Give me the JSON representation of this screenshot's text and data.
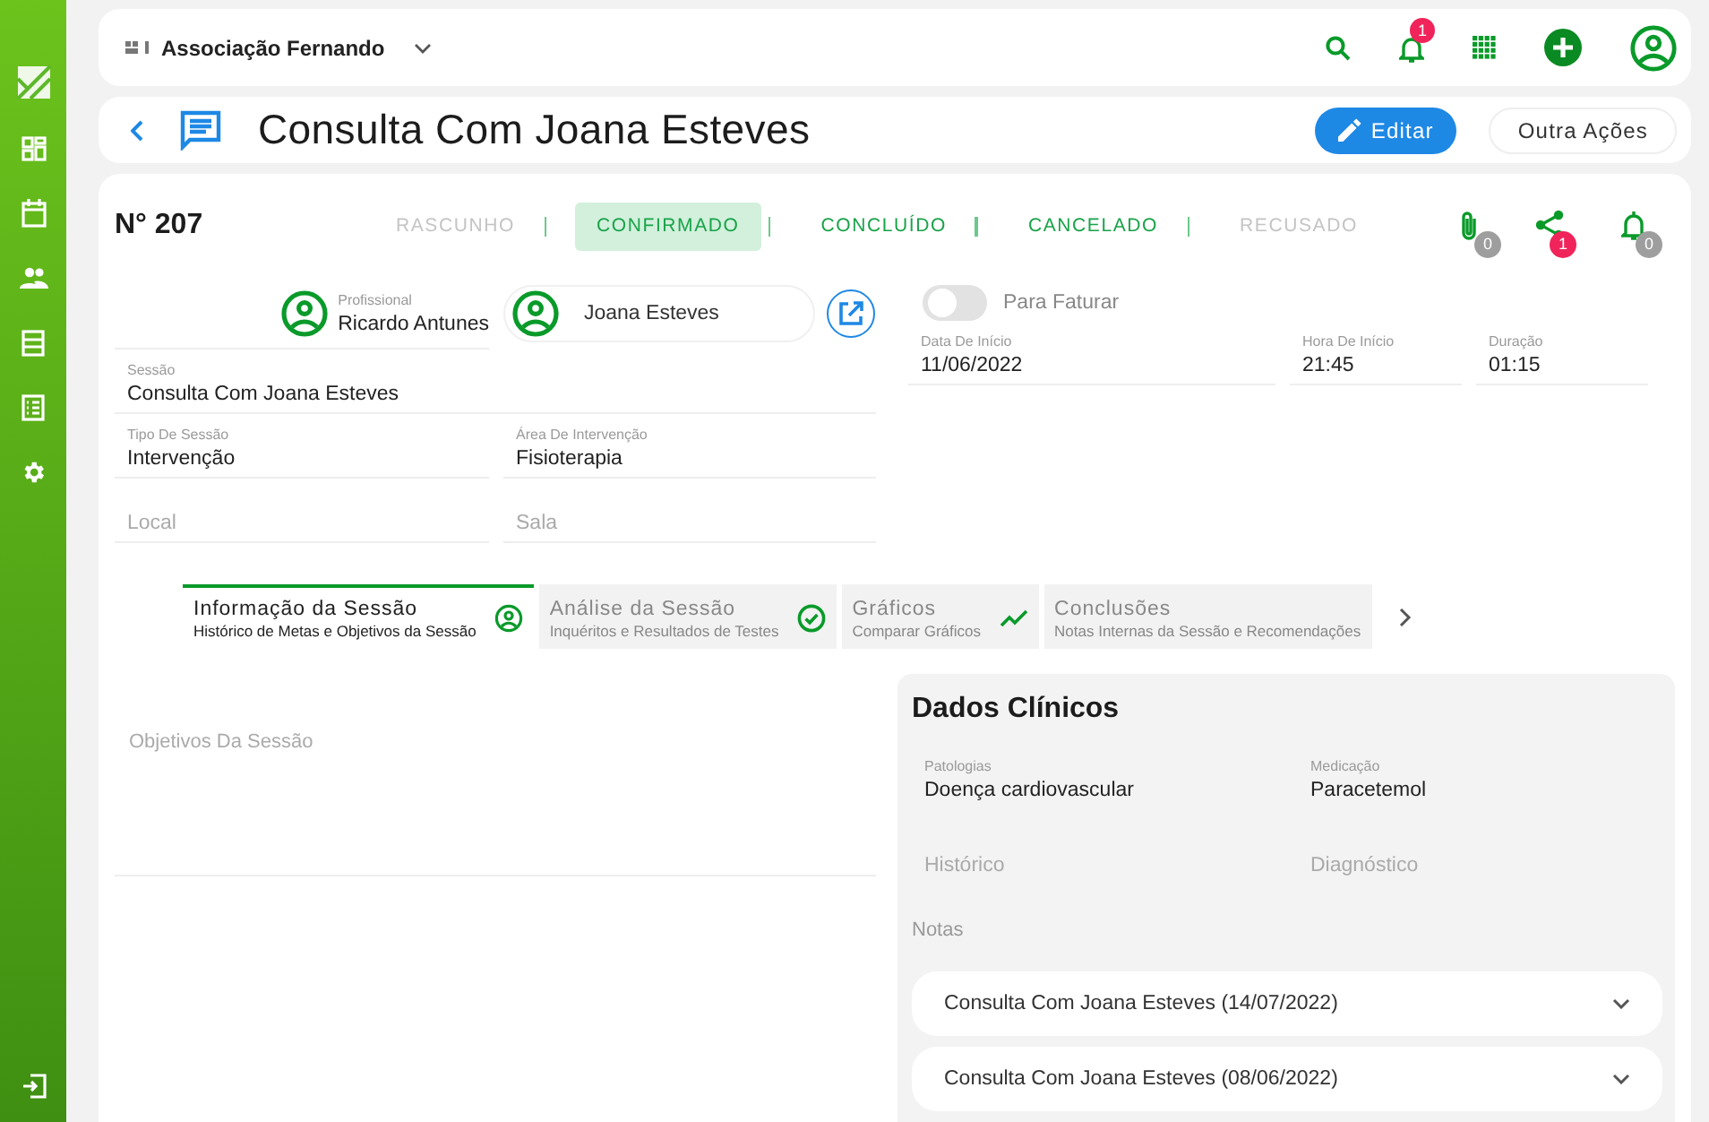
{
  "sidebar": {
    "items": [
      {
        "kind": "logo"
      },
      {
        "kind": "dashboard",
        "selected": false
      },
      {
        "kind": "calendar",
        "selected": false
      },
      {
        "kind": "people",
        "selected": false
      },
      {
        "kind": "list",
        "selected": false
      },
      {
        "kind": "checklist",
        "selected": false
      },
      {
        "kind": "settings",
        "selected": false
      },
      {
        "kind": "logout",
        "selected": false
      }
    ]
  },
  "header": {
    "organization": "Associação Fernando",
    "notification_count": "1"
  },
  "page": {
    "title": "Consulta Com Joana Esteves",
    "buttons": [
      {
        "label": "Editar",
        "kind": "primary"
      },
      {
        "label": "Outra Ações",
        "kind": "outline"
      }
    ]
  },
  "record": {
    "number": "N° 207",
    "statuses": [
      {
        "label": "RASCUNHO",
        "selected": false,
        "disabled": true
      },
      {
        "label": "CONFIRMADO",
        "selected": true,
        "disabled": false
      },
      {
        "label": "CONCLUÍDO",
        "selected": false,
        "disabled": false
      },
      {
        "label": "CANCELADO",
        "selected": false,
        "disabled": false
      },
      {
        "label": "RECUSADO",
        "selected": false,
        "disabled": true
      }
    ],
    "actions": [
      {
        "kind": "attachment",
        "count": "0",
        "alert": false
      },
      {
        "kind": "share",
        "count": "1",
        "alert": true
      },
      {
        "kind": "bell",
        "count": "0",
        "alert": false
      }
    ],
    "professional": {
      "label": "Profissional",
      "value": "Ricardo Antunes"
    },
    "patient": {
      "value": "Joana Esteves"
    },
    "billing": {
      "label": "Para Faturar",
      "on": false
    },
    "fields": [
      {
        "label": "Sessão",
        "value": "Consulta Com Joana Esteves"
      },
      {
        "label": "Tipo De Sessão",
        "value": "Intervenção"
      },
      {
        "label": "Área De Intervenção",
        "value": "Fisioterapia"
      },
      {
        "placeholder": "Local"
      },
      {
        "placeholder": "Sala"
      }
    ],
    "schedule": [
      {
        "label": "Data De Início",
        "value": "11/06/2022"
      },
      {
        "label": "Hora De Início",
        "value": "21:45"
      },
      {
        "label": "Duração",
        "value": "01:15"
      }
    ]
  },
  "tabs": [
    {
      "title": "Informação da Sessão",
      "subtitle": "Histórico de Metas e Objetivos da Sessão",
      "kind": "person",
      "selected": true
    },
    {
      "title": "Análise da Sessão",
      "subtitle": "Inquéritos e Resultados de Testes",
      "kind": "check",
      "selected": false
    },
    {
      "title": "Gráficos",
      "subtitle": "Comparar Gráficos",
      "kind": "trend",
      "selected": false
    },
    {
      "title": "Conclusões",
      "subtitle": "Notas Internas da Sessão e Recomendações",
      "kind": "text",
      "selected": false
    }
  ],
  "objectives": {
    "placeholder": "Objetivos Da Sessão"
  },
  "clinical": {
    "title": "Dados Clínicos",
    "fields": [
      {
        "label": "Patologias",
        "value": "Doença cardiovascular"
      },
      {
        "label": "Medicação",
        "value": "Paracetemol"
      },
      {
        "placeholder": "Histórico"
      },
      {
        "placeholder": "Diagnóstico"
      }
    ],
    "notes_label": "Notas",
    "notes": [
      {
        "title": "Consulta Com Joana Esteves (14/07/2022)",
        "expanded": false
      },
      {
        "title": "Consulta Com Joana Esteves (08/06/2022)",
        "expanded": false
      }
    ]
  }
}
